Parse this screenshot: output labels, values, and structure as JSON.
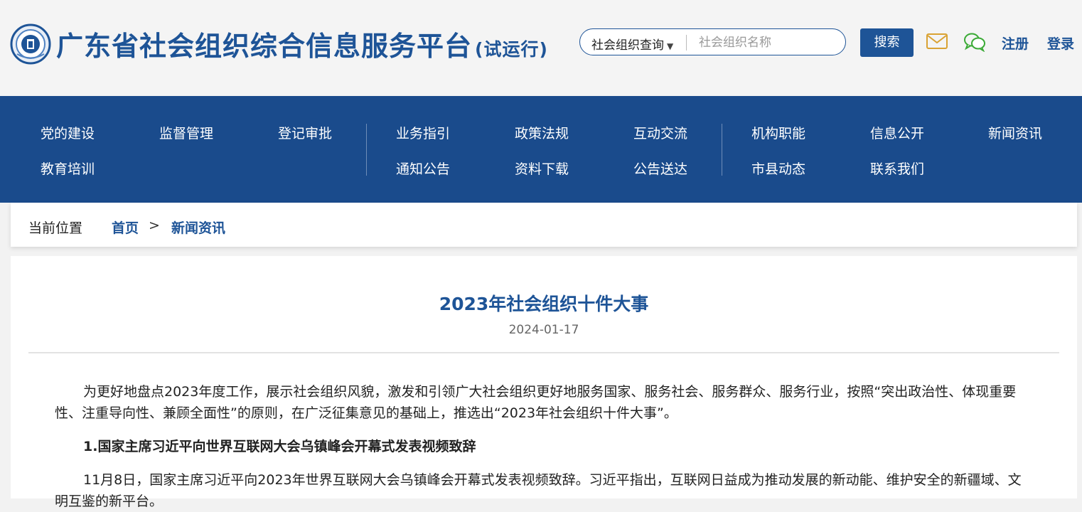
{
  "header": {
    "title": "广东省社会组织综合信息服务平台",
    "title_suffix": "(试运行)",
    "search": {
      "type_label": "社会组织查询",
      "placeholder": "社会组织名称",
      "value": ""
    },
    "search_button": "搜索",
    "register": "注册",
    "login": "登录",
    "icons": [
      "mail-icon",
      "wechat-icon"
    ]
  },
  "nav": {
    "items": [
      "党的建设",
      "监督管理",
      "登记审批",
      "业务指引",
      "政策法规",
      "互动交流",
      "机构职能",
      "信息公开",
      "新闻资讯",
      "教育培训",
      "通知公告",
      "资料下载",
      "公告送达",
      "市县动态",
      "联系我们"
    ]
  },
  "breadcrumb": {
    "label": "当前位置",
    "home": "首页",
    "separator": ">",
    "current": "新闻资讯"
  },
  "article": {
    "title": "2023年社会组织十件大事",
    "date": "2024-01-17",
    "intro": "为更好地盘点2023年度工作，展示社会组织风貌，激发和引领广大社会组织更好地服务国家、服务社会、服务群众、服务行业，按照“突出政治性、体现重要性、注重导向性、兼顾全面性”的原则，在广泛征集意见的基础上，推选出“2023年社会组织十件大事”。",
    "item1_heading": "1.国家主席习近平向世界互联网大会乌镇峰会开幕式发表视频致辞",
    "item1_text": "11月8日，国家主席习近平向2023年世界互联网大会乌镇峰会开幕式发表视频致辞。习近平指出，互联网日益成为推动发展的新动能、维护安全的新疆域、文明互鉴的新平台。"
  },
  "colors": {
    "brand_blue": "#1e5497",
    "nav_blue": "#1a4b8c",
    "mail_icon": "#d9a233",
    "wechat_icon": "#3aaa35"
  }
}
